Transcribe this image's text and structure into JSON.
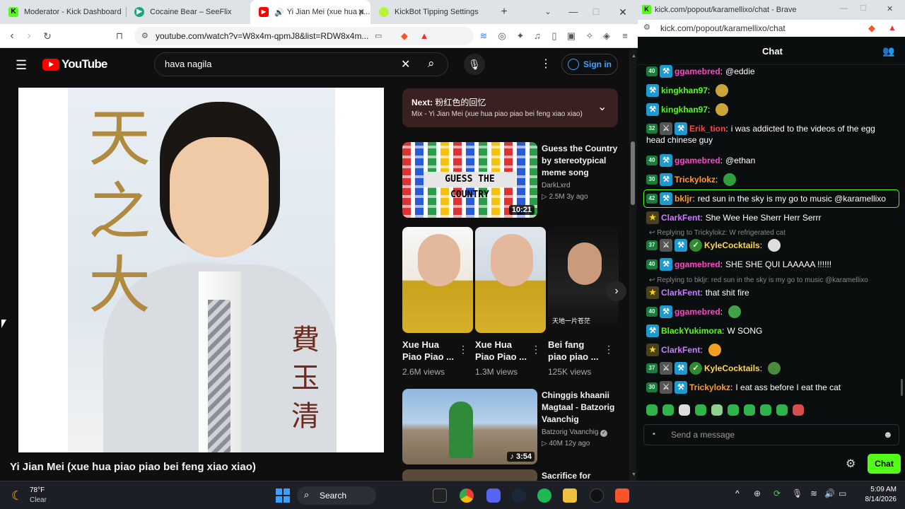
{
  "browser_left": {
    "tabs": [
      {
        "title": "Moderator - Kick Dashboard"
      },
      {
        "title": "Cocaine Bear – SeeFlix"
      },
      {
        "title": "Yi Jian Mei (xue hua p..."
      },
      {
        "title": "KickBot Tipping Settings"
      }
    ],
    "url": "youtube.com/watch?v=W8x4m-qpmJ8&list=RDW8x4m..."
  },
  "youtube": {
    "logo_text": "YouTube",
    "search_value": "hava nagila",
    "sign_in": "Sign in",
    "video_title": "Yi Jian Mei (xue hua piao piao bei feng xiao xiao)",
    "overlay_chars_left": "天之大",
    "overlay_chars_right": "費玉清",
    "next": {
      "label": "Next:",
      "title": "粉红色的回忆",
      "subtitle": "Mix - Yi Jian Mei (xue hua piao piao bei feng xiao xiao)"
    },
    "recommendations": [
      {
        "title": "Guess the Country by stereotypical meme song",
        "channel": "DarkLxrd",
        "views": "2.5M",
        "age": "3y ago",
        "duration": "10:21",
        "thumb_text": "GUESS THE COUNTRY"
      },
      {
        "title": "Chinggis khaanii Magtaal - Batzorig Vaanchig",
        "channel": "Batzorig Vaanchig",
        "views": "40M",
        "age": "12y ago",
        "duration": "3:54"
      },
      {
        "title": "Sacrifice for",
        "channel": "",
        "views": "",
        "age": "",
        "duration": ""
      }
    ],
    "shorts": [
      {
        "title": "Xue Hua Piao Piao ...",
        "views": "2.6M views"
      },
      {
        "title": "Xue Hua Piao Piao ...",
        "views": "1.3M views"
      },
      {
        "title": "Bei fang piao piao ...",
        "views": "125K views"
      }
    ],
    "short3_caption": "天地一片苍茫"
  },
  "browser_right": {
    "window_title": "kick.com/popout/karamellixo/chat - Brave",
    "url": "kick.com/popout/karamellixo/chat",
    "chat_title": "Chat",
    "input_placeholder": "Send a message",
    "chat_button": "Chat"
  },
  "chat": [
    {
      "level": "40",
      "badges": [
        "mod"
      ],
      "user": "ggamebred",
      "color": "#ff44c8",
      "text": "@eddie"
    },
    {
      "level": "",
      "badges": [
        "mod"
      ],
      "user": "kingkhan97",
      "color": "#53fc18",
      "text": "",
      "emote": "#c9a53a"
    },
    {
      "level": "",
      "badges": [
        "mod"
      ],
      "user": "kingkhan97",
      "color": "#53fc18",
      "text": "",
      "emote": "#c9a53a"
    },
    {
      "level": "32",
      "badges": [
        "vip",
        "mod"
      ],
      "user": "Erik_tion",
      "color": "#ff4545",
      "text": "i was addicted to the videos of the egg",
      "text2": "head chinese guy"
    },
    {
      "level": "40",
      "badges": [
        "mod"
      ],
      "user": "ggamebred",
      "color": "#ff44c8",
      "text": "@ethan"
    },
    {
      "level": "30",
      "badges": [
        "mod"
      ],
      "user": "Trickylokz",
      "color": "#ff9a2e",
      "text": "",
      "emote": "#2f9e3e"
    },
    {
      "level": "42",
      "badges": [
        "mod"
      ],
      "user": "bkljr",
      "color": "#ff9a2e",
      "text": "red sun in the sky is my go to music @karamellixo"
    },
    {
      "level": "",
      "badges": [
        "og"
      ],
      "user": "ClarkFent",
      "color": "#c77dff",
      "text": "She Wee Hee Sherr Herr Serrr"
    },
    {
      "reply": "Replying to Trickylokz: W refrigerated cat"
    },
    {
      "level": "37",
      "badges": [
        "vip",
        "mod",
        "ver"
      ],
      "user": "KyleCocktails",
      "color": "#ffd84a",
      "text": "",
      "emote": "#dddddd"
    },
    {
      "level": "40",
      "badges": [
        "mod"
      ],
      "user": "ggamebred",
      "color": "#ff44c8",
      "text": "SHE SHE QUI LAAAAA !!!!!!"
    },
    {
      "reply": "Replying to bkljr: red sun in the sky is my go to music @karamellixo"
    },
    {
      "level": "",
      "badges": [
        "og"
      ],
      "user": "ClarkFent",
      "color": "#c77dff",
      "text": "that shit fire"
    },
    {
      "level": "40",
      "badges": [
        "mod"
      ],
      "user": "ggamebred",
      "color": "#ff44c8",
      "text": "",
      "emote": "#3fa34a"
    },
    {
      "level": "",
      "badges": [
        "mod"
      ],
      "user": "BlackYukimora",
      "color": "#53fc18",
      "text": "W SONG"
    },
    {
      "level": "",
      "badges": [
        "og"
      ],
      "user": "ClarkFent",
      "color": "#c77dff",
      "text": "",
      "emote": "#f0a020"
    },
    {
      "level": "37",
      "badges": [
        "vip",
        "mod",
        "ver"
      ],
      "user": "KyleCocktails",
      "color": "#ffd84a",
      "text": "",
      "emote": "#4a8a3a"
    },
    {
      "level": "30",
      "badges": [
        "vip",
        "mod"
      ],
      "user": "Trickylokz",
      "color": "#ff9a2e",
      "text": "I eat ass before I eat the cat"
    }
  ],
  "taskbar": {
    "temp": "78°F",
    "weather": "Clear",
    "search": "Search",
    "time": "5:09 AM",
    "date": "8/14/2026"
  }
}
